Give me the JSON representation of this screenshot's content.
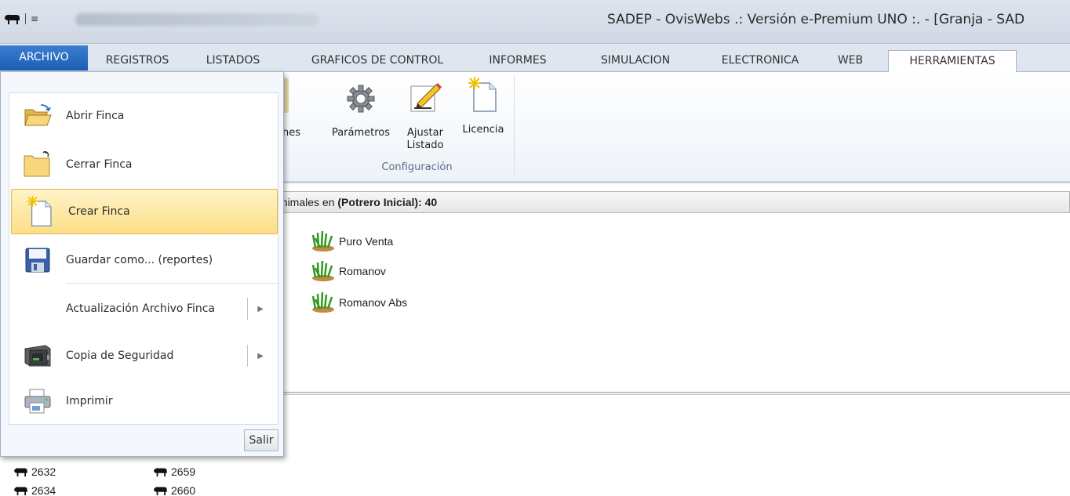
{
  "window": {
    "title": "SADEP - OvisWebs  .: Versión e-Premium UNO :. - [Granja - SAD"
  },
  "tabs": [
    {
      "label": "ARCHIVO"
    },
    {
      "label": "REGISTROS"
    },
    {
      "label": "LISTADOS"
    },
    {
      "label": "GRAFICOS DE CONTROL"
    },
    {
      "label": "INFORMES"
    },
    {
      "label": "SIMULACION"
    },
    {
      "label": "ELECTRONICA"
    },
    {
      "label": "WEB"
    },
    {
      "label": "HERRAMIENTAS"
    }
  ],
  "ribbon": {
    "partial_label": "ones",
    "group_label": "Configuración",
    "buttons": [
      {
        "label": "Parámetros",
        "icon": "gear-icon"
      },
      {
        "label": "Ajustar Listado",
        "icon": "pencil-edit-icon"
      },
      {
        "label": "Licencia",
        "icon": "new-document-icon"
      }
    ]
  },
  "menu": {
    "items": [
      {
        "label": "Abrir Finca",
        "icon": "open-folder-icon"
      },
      {
        "label": "Cerrar Finca",
        "icon": "folder-icon"
      },
      {
        "label": "Crear Finca",
        "icon": "new-document-icon",
        "highlighted": true
      },
      {
        "label": "Guardar como... (reportes)",
        "icon": "save-icon"
      },
      {
        "label": "Actualización Archivo Finca",
        "has_submenu": true
      },
      {
        "label": "Copia de Seguridad",
        "icon": "safe-icon",
        "has_submenu": true
      },
      {
        "label": "Imprimir",
        "icon": "printer-icon"
      }
    ],
    "exit_label": "Salir"
  },
  "content": {
    "info_prefix": "animales en ",
    "info_bold": "(Potrero Inicial): 40",
    "pastures": [
      "Puro Venta",
      "Romanov",
      "Romanov Abs"
    ],
    "animals": [
      "2632",
      "2659",
      "2634",
      "2660"
    ]
  },
  "colors": {
    "accent": "#1c5db5",
    "highlight": "#fbdf86"
  }
}
